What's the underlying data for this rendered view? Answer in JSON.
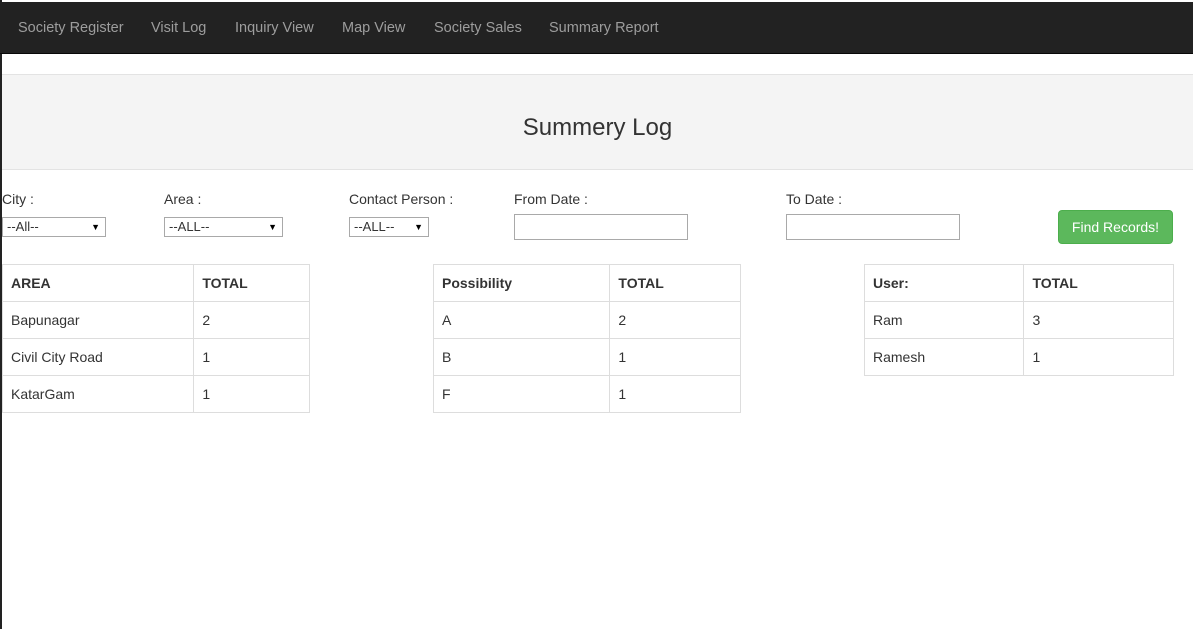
{
  "navbar": {
    "items": [
      {
        "label": "Society Register"
      },
      {
        "label": "Visit Log"
      },
      {
        "label": "Inquiry View"
      },
      {
        "label": "Map View"
      },
      {
        "label": "Society Sales"
      },
      {
        "label": "Summary Report"
      }
    ]
  },
  "header": {
    "title": "Summery Log"
  },
  "filters": {
    "city": {
      "label": "City :",
      "selected": "--All--"
    },
    "area": {
      "label": "Area :",
      "selected": "--ALL--"
    },
    "contact_person": {
      "label": "Contact Person :",
      "selected": "--ALL--"
    },
    "from_date": {
      "label": "From Date :",
      "value": ""
    },
    "to_date": {
      "label": "To Date :",
      "value": ""
    },
    "submit_label": "Find Records!"
  },
  "area_table": {
    "headers": [
      "AREA",
      "TOTAL"
    ],
    "rows": [
      [
        "Bapunagar",
        "2"
      ],
      [
        "Civil City Road",
        "1"
      ],
      [
        "KatarGam",
        "1"
      ]
    ]
  },
  "possibility_table": {
    "headers": [
      "Possibility",
      "TOTAL"
    ],
    "rows": [
      [
        "A",
        "2"
      ],
      [
        "B",
        "1"
      ],
      [
        "F",
        "1"
      ]
    ]
  },
  "user_table": {
    "headers": [
      "User:",
      "TOTAL"
    ],
    "rows": [
      [
        "Ram",
        "3"
      ],
      [
        "Ramesh",
        "1"
      ]
    ]
  },
  "colors": {
    "navbar_bg": "#222222",
    "nav_text": "#9d9d9d",
    "header_bg": "#f4f4f4",
    "button_bg": "#5cb85c"
  }
}
